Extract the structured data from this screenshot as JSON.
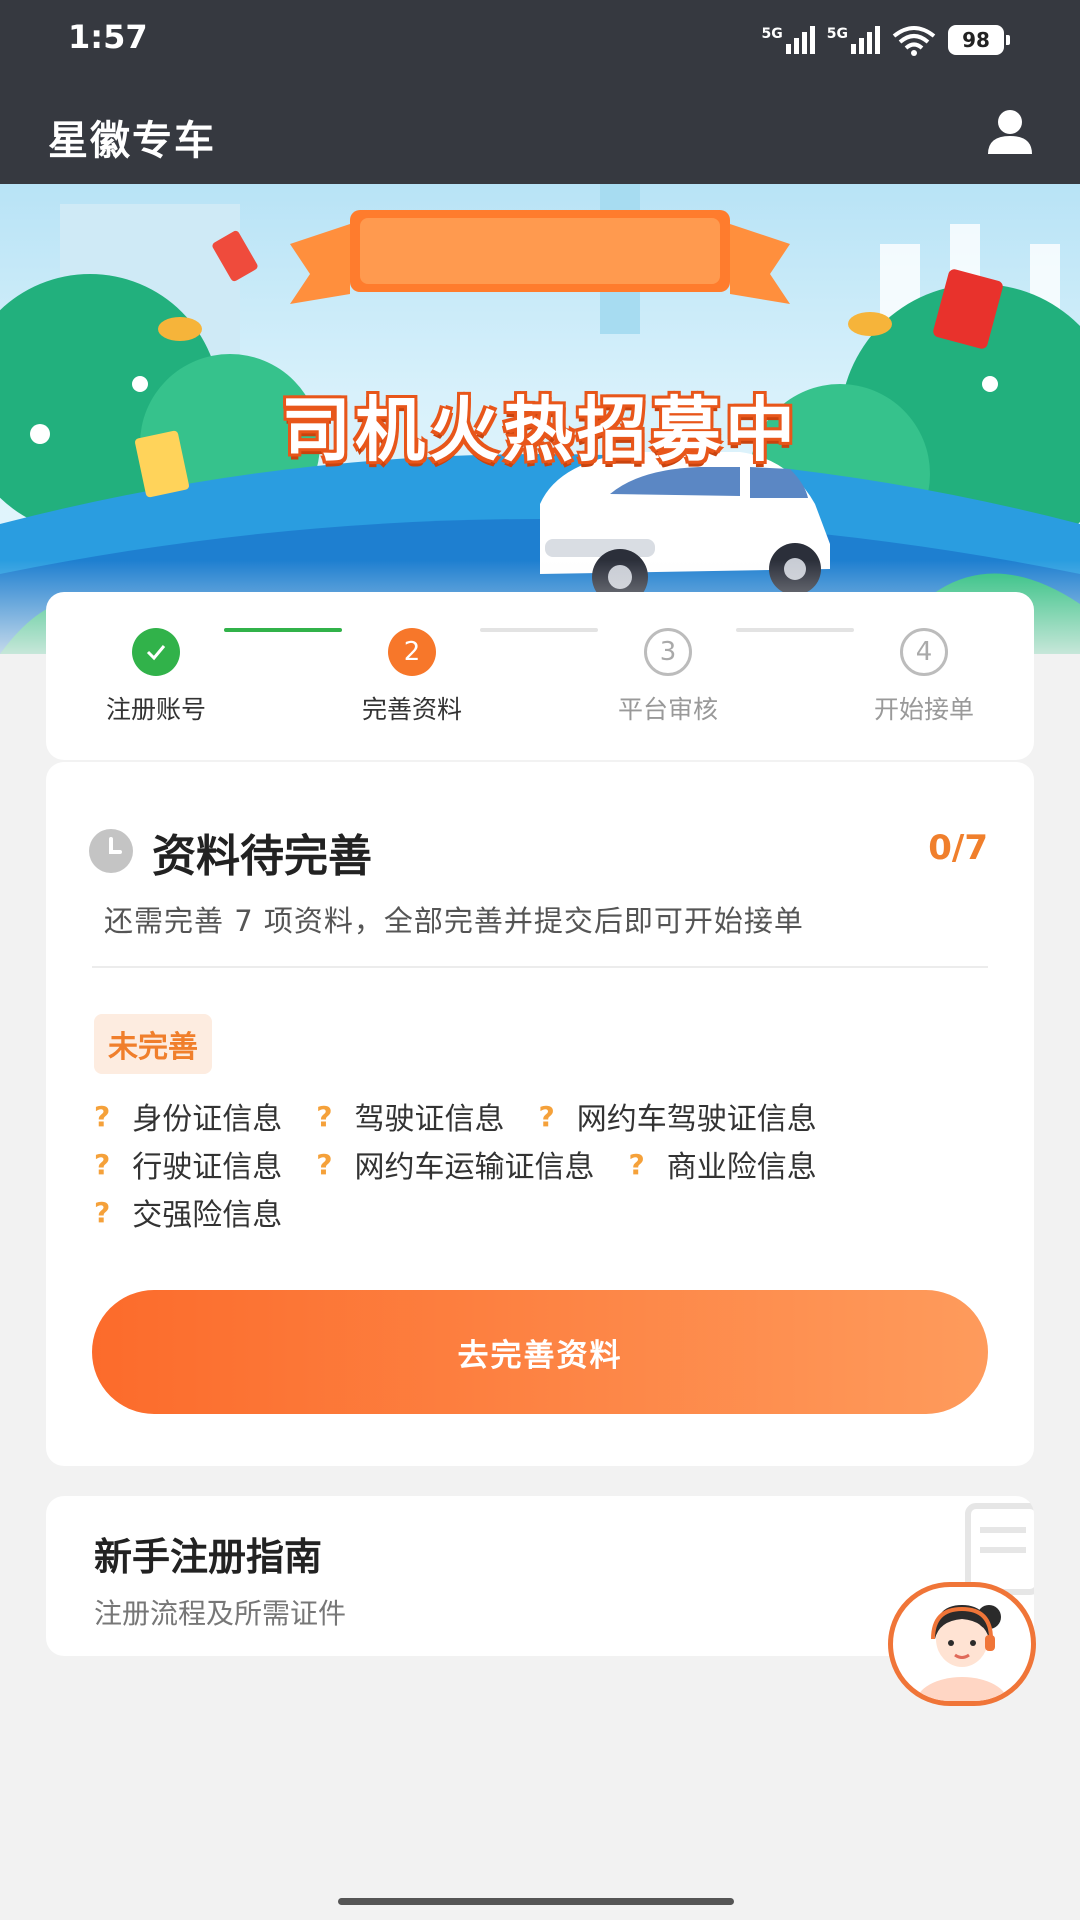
{
  "status_bar": {
    "time": "1:57",
    "network_1": "5G",
    "network_2": "5G",
    "battery": "98"
  },
  "header": {
    "title": "星徽专车"
  },
  "banner": {
    "headline": "司机火热招募中"
  },
  "steps": [
    {
      "number": "1",
      "label": "注册账号",
      "state": "done"
    },
    {
      "number": "2",
      "label": "完善资料",
      "state": "active"
    },
    {
      "number": "3",
      "label": "平台审核",
      "state": "todo"
    },
    {
      "number": "4",
      "label": "开始接单",
      "state": "todo"
    }
  ],
  "info": {
    "title": "资料待完善",
    "count": "0/7",
    "description": "还需完善 7 项资料，全部完善并提交后即可开始接单",
    "badge": "未完善",
    "item_marker": "?",
    "items": [
      "身份证信息",
      "驾驶证信息",
      "网约车驾驶证信息",
      "行驶证信息",
      "网约车运输证信息",
      "商业险信息",
      "交强险信息"
    ],
    "button_label": "去完善资料"
  },
  "guide": {
    "title": "新手注册指南",
    "subtitle": "注册流程及所需证件"
  },
  "colors": {
    "accent": "#f07f2c",
    "done": "#31b24a",
    "header_bg": "#363940"
  }
}
